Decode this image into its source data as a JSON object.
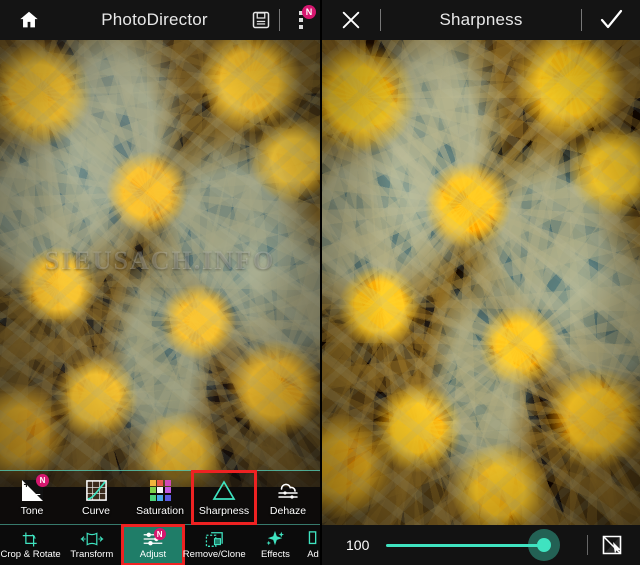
{
  "left_panel": {
    "header": {
      "home_icon": "home-icon",
      "title": "PhotoDirector",
      "save_icon": "save-icon",
      "menu_icon": "overflow-menu-icon",
      "menu_badge": "N"
    },
    "photo": {
      "watermark": "SIEUSACH.INFO"
    },
    "adjust_tools": [
      {
        "label": "Tone",
        "icon": "tone-icon",
        "badge": "N",
        "selected": false
      },
      {
        "label": "Curve",
        "icon": "curve-icon",
        "badge": "",
        "selected": false
      },
      {
        "label": "Saturation",
        "icon": "saturation-icon",
        "badge": "",
        "selected": false
      },
      {
        "label": "Sharpness",
        "icon": "sharpness-icon",
        "badge": "",
        "selected": true
      },
      {
        "label": "Dehaze",
        "icon": "dehaze-icon",
        "badge": "",
        "selected": false
      }
    ],
    "bottom_nav": [
      {
        "label": "Crop & Rotate",
        "icon": "crop-rotate-icon",
        "badge": "",
        "active": false
      },
      {
        "label": "Transform",
        "icon": "transform-icon",
        "badge": "",
        "active": false
      },
      {
        "label": "Adjust",
        "icon": "adjust-icon",
        "badge": "N",
        "active": true
      },
      {
        "label": "Remove/Clone",
        "icon": "remove-clone-icon",
        "badge": "",
        "active": false
      },
      {
        "label": "Effects",
        "icon": "effects-icon",
        "badge": "",
        "active": false
      },
      {
        "label": "Ad",
        "icon": "more-icon",
        "badge": "",
        "active": false
      }
    ]
  },
  "right_panel": {
    "header": {
      "close_icon": "close-icon",
      "title": "Sharpness",
      "confirm_icon": "check-icon"
    },
    "slider": {
      "value": "100",
      "percent": 100,
      "compare_icon": "compare-icon"
    }
  },
  "colors": {
    "accent_teal": "#3fe3c0",
    "highlight_red": "#ee2222",
    "badge_pink": "#d6176f",
    "nav_active_bg": "#1f7d68"
  }
}
